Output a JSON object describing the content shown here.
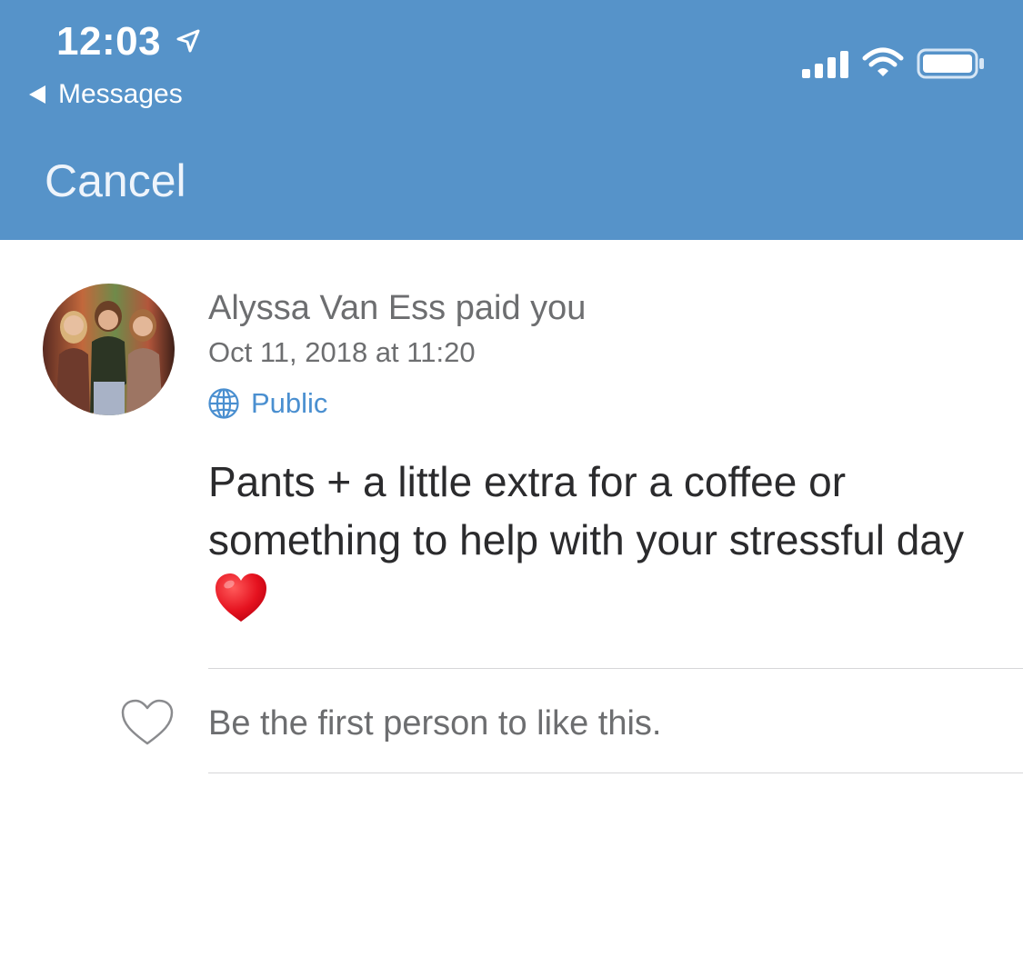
{
  "status_bar": {
    "time": "12:03",
    "back_label": "Messages",
    "icons": [
      "location-arrow-icon",
      "cellular-signal-icon",
      "wifi-icon",
      "battery-icon"
    ]
  },
  "nav": {
    "cancel_label": "Cancel"
  },
  "payment": {
    "sender_line": "Alyssa Van Ess paid you",
    "date_line": "Oct 11, 2018 at 11:20",
    "privacy_label": "Public",
    "note_text": "Pants + a little extra for a coffee or something to help with your stressful day",
    "note_emoji": "red-heart-emoji"
  },
  "likes": {
    "text": "Be the first person to like this."
  },
  "colors": {
    "header_bg": "#5693c9",
    "header_text": "#ffffff",
    "link_blue": "#4a8fd0",
    "secondary_text": "#6d6e70",
    "primary_text": "#2b2b2d",
    "divider": "#d6d6d8"
  }
}
